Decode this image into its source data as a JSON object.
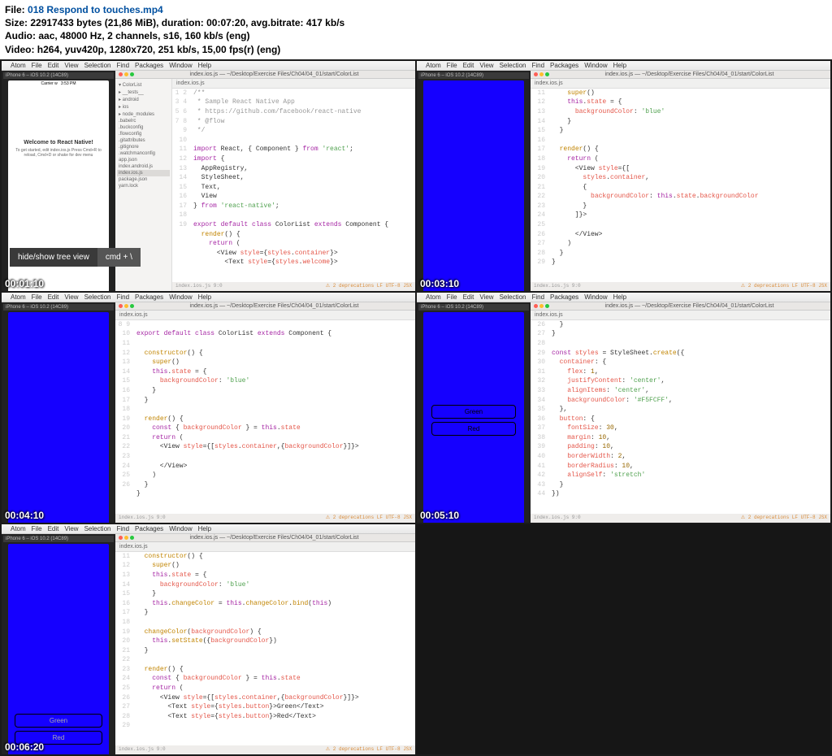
{
  "file_info": {
    "file_label": "File:",
    "file_name": "018 Respond to touches.mp4",
    "size_label": "Size:",
    "size_value": "22917433 bytes (21,86 MiB), duration: 00:07:20, avg.bitrate: 417 kb/s",
    "audio_label": "Audio:",
    "audio_value": "aac, 48000 Hz, 2 channels, s16, 160 kb/s (eng)",
    "video_label": "Video:",
    "video_value": "h264, yuv420p, 1280x720, 251 kb/s, 15,00 fps(r) (eng)"
  },
  "menubar": [
    "Atom",
    "File",
    "Edit",
    "View",
    "Selection",
    "Find",
    "Packages",
    "Window",
    "Help"
  ],
  "window_title": "index.ios.js — ~/Desktop/Exercise Files/Ch04/04_01/start/ColorList",
  "tab_name": "index.ios.js",
  "sim_header": "iPhone 6 – iOS 10.2 (14C89)",
  "sim_carrier": "Carrier ᴡ",
  "sim_time": "3:53 PM",
  "welcome_title": "Welcome to React Native!",
  "welcome_sub": "To get started, edit index.ios.js\nPress Cmd+R to reload,\nCmd+D or shake for dev menu",
  "sim_btn_green": "Green",
  "sim_btn_red": "Red",
  "kbd_tip_left": "hide/show tree view",
  "kbd_tip_right": "cmd + \\",
  "statusbar_left": "index.ios.js  9:0",
  "statusbar_right": "⚠ 2 deprecations  LF  UTF-8  JSX",
  "tree_items": [
    "▾ ColorList",
    "  ▸ __tests__",
    "  ▸ android",
    "  ▸ ios",
    "  ▸ node_modules",
    "  .babelrc",
    "  .buckconfig",
    "  .flowconfig",
    "  .gitattributes",
    "  .gitignore",
    "  .watchmanconfig",
    "  app.json",
    "  index.android.js",
    "  index.ios.js",
    "  package.json",
    "  yarn.lock"
  ],
  "timestamps": [
    "00:01:10",
    "00:03:10",
    "00:04:10",
    "00:05:10",
    "00:06:20"
  ],
  "code1": {
    "start": 1,
    "lines": [
      "/**",
      " * Sample React Native App",
      " * https://github.com/facebook/react-native",
      " * @flow",
      " */",
      "",
      "import React, { Component } from 'react';",
      "import {",
      "  AppRegistry,",
      "  StyleSheet,",
      "  Text,",
      "  View",
      "} from 'react-native';",
      "",
      "export default class ColorList extends Component {",
      "  render() {",
      "    return (",
      "      <View style={styles.container}>",
      "        <Text style={styles.welcome}>"
    ]
  },
  "code2": {
    "start": 11,
    "lines": [
      "    super()",
      "    this.state = {",
      "      backgroundColor: 'blue'",
      "    }",
      "  }",
      "",
      "  render() {",
      "    return (",
      "      <View style={[",
      "        styles.container,",
      "        {",
      "          backgroundColor: this.state.backgroundColor",
      "        }",
      "      ]}>",
      "",
      "      </View>",
      "    )",
      "  }",
      "}"
    ]
  },
  "code3": {
    "start": 8,
    "lines": [
      "",
      "export default class ColorList extends Component {",
      "",
      "  constructor() {",
      "    super()",
      "    this.state = {",
      "      backgroundColor: 'blue'",
      "    }",
      "  }",
      "",
      "  render() {",
      "    const { backgroundColor } = this.state",
      "    return (",
      "      <View style={[styles.container,{backgroundColor}]}>",
      "",
      "      </View>",
      "    )",
      "  }",
      "}"
    ]
  },
  "code4": {
    "start": 26,
    "lines": [
      "  }",
      "}",
      "",
      "const styles = StyleSheet.create({",
      "  container: {",
      "    flex: 1,",
      "    justifyContent: 'center',",
      "    alignItems: 'center',",
      "    backgroundColor: '#F5FCFF',",
      "  },",
      "  button: {",
      "    fontSize: 30,",
      "    margin: 10,",
      "    padding: 10,",
      "    borderWidth: 2,",
      "    borderRadius: 10,",
      "    alignSelf: 'stretch'",
      "  }",
      "})"
    ]
  },
  "code5": {
    "start": 11,
    "lines": [
      "  constructor() {",
      "    super()",
      "    this.state = {",
      "      backgroundColor: 'blue'",
      "    }",
      "    this.changeColor = this.changeColor.bind(this)",
      "  }",
      "",
      "  changeColor(backgroundColor) {",
      "    this.setState({backgroundColor})",
      "  }",
      "",
      "  render() {",
      "    const { backgroundColor } = this.state",
      "    return (",
      "      <View style={[styles.container,{backgroundColor}]}>",
      "        <Text style={styles.button}>Green</Text>",
      "        <Text style={styles.button}>Red</Text>",
      ""
    ]
  }
}
